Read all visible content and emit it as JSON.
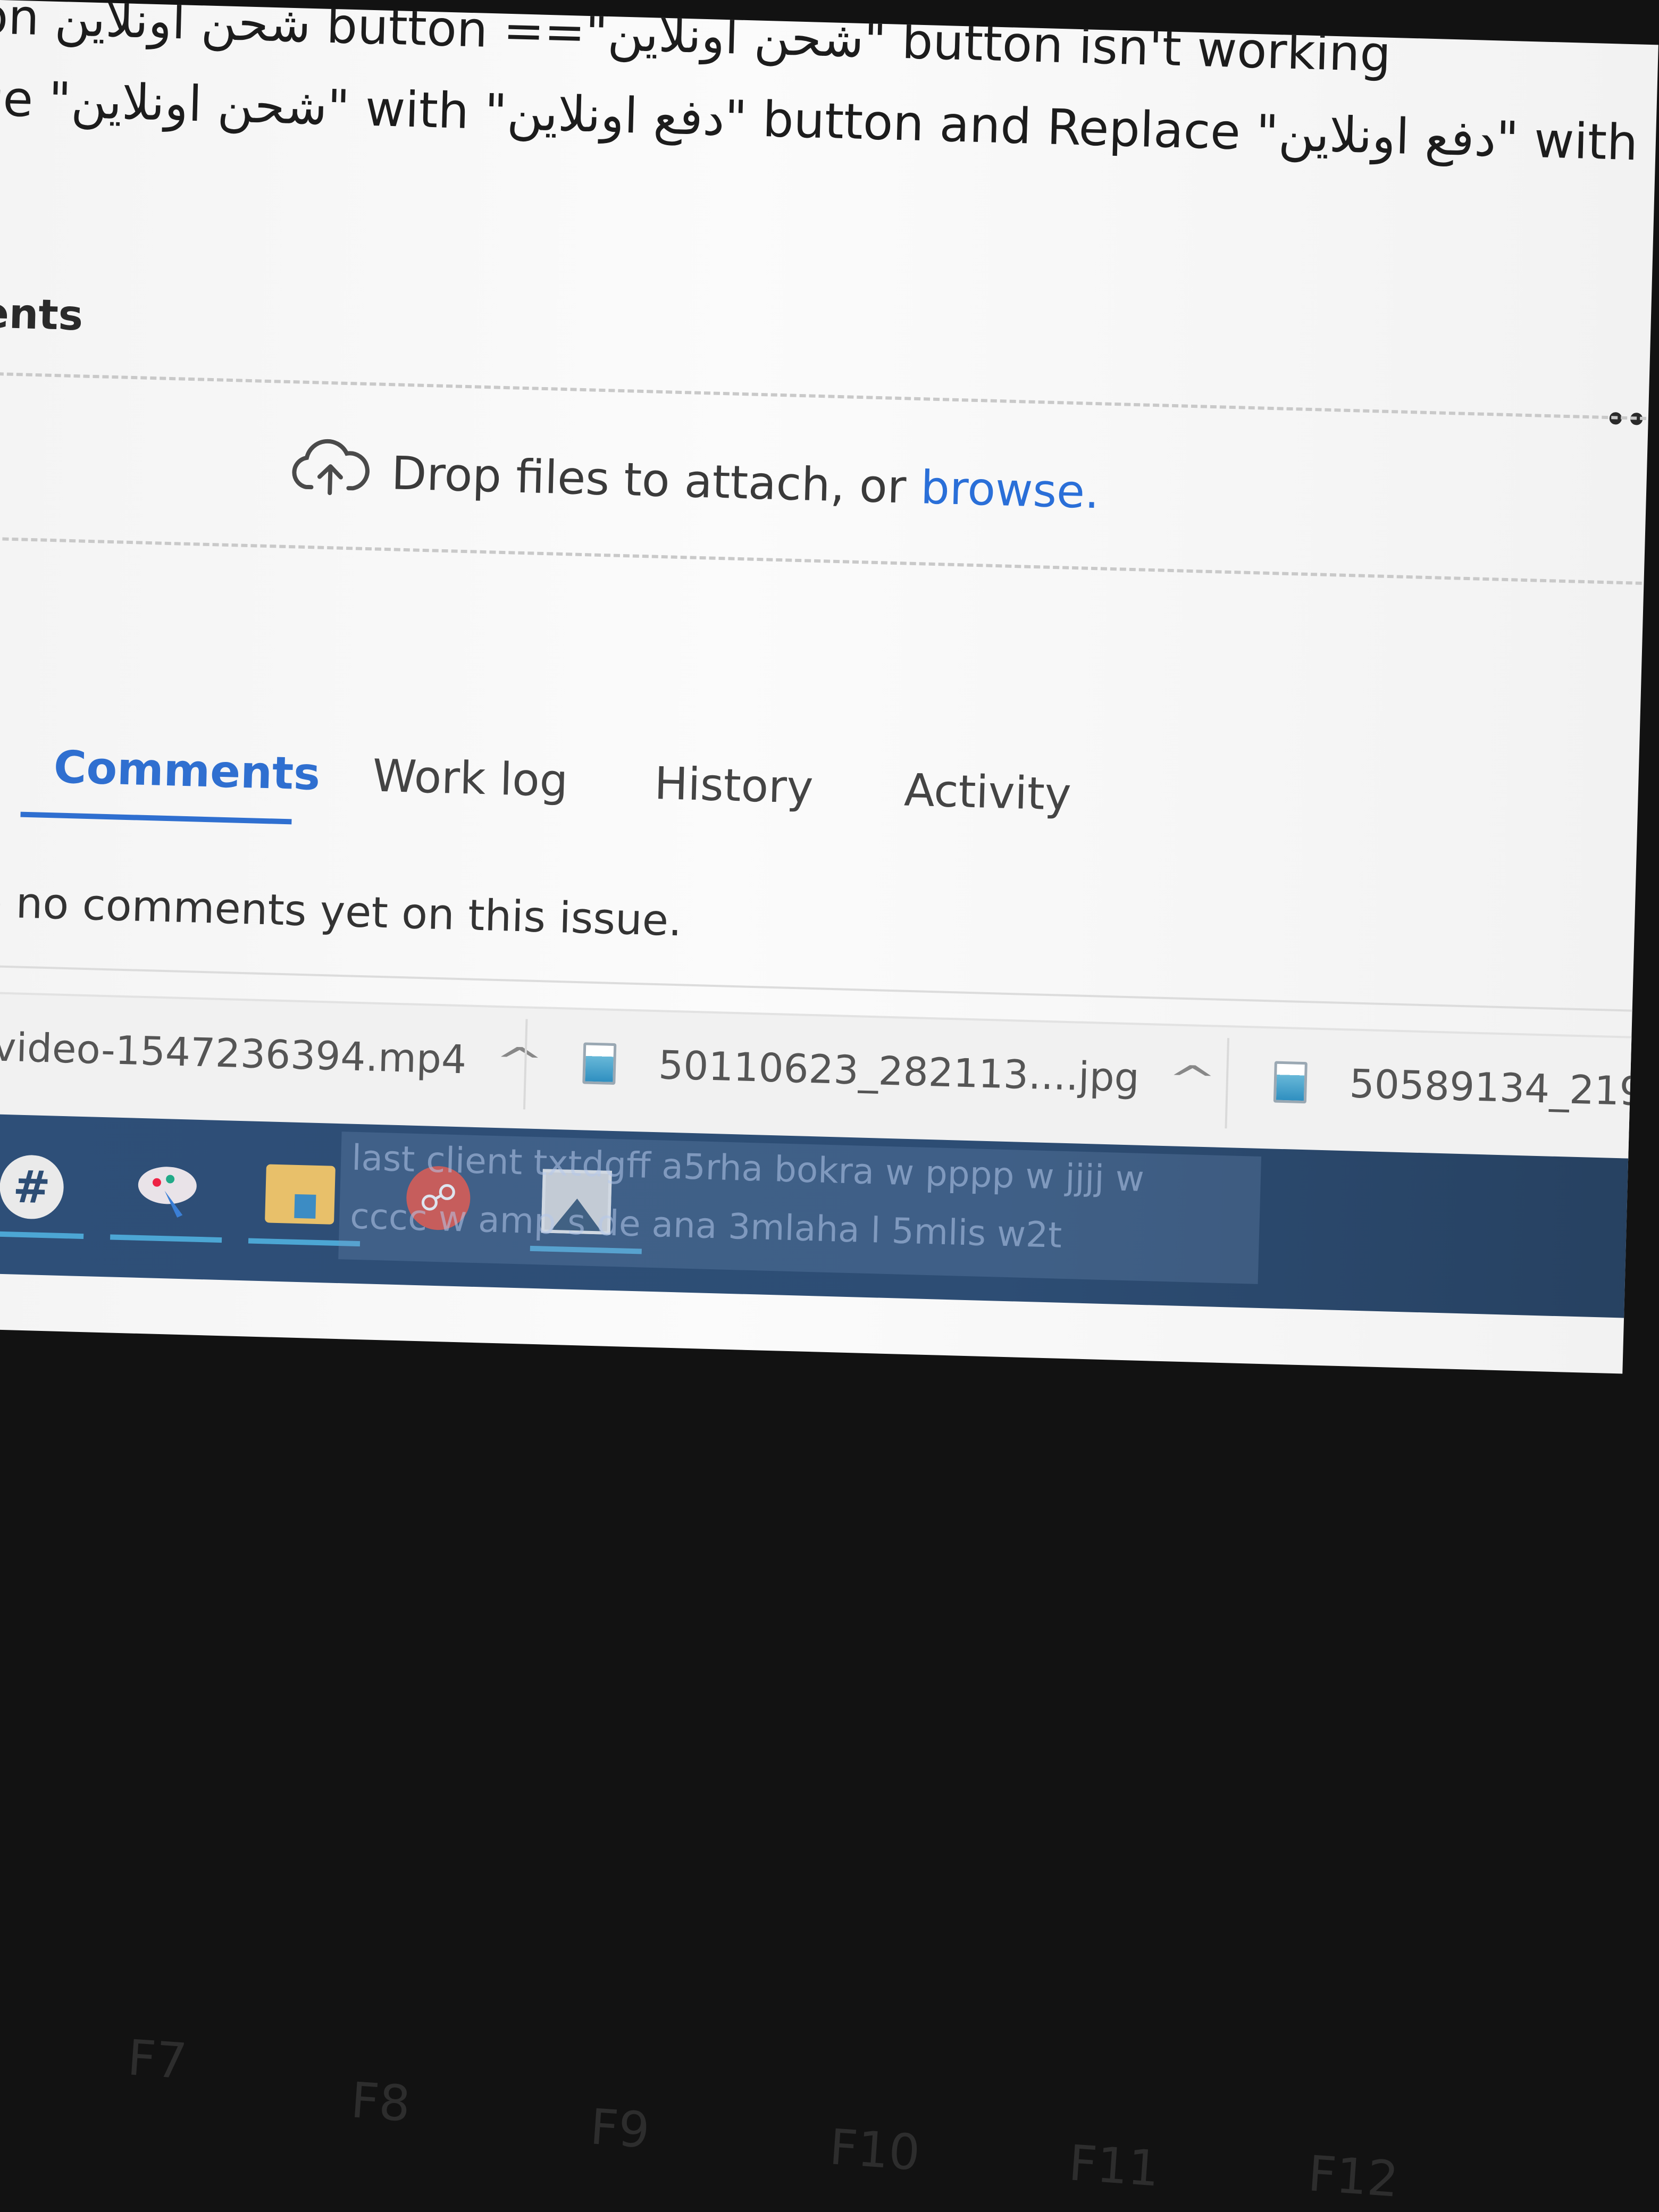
{
  "description": {
    "line1": "on  شحن اونلاين  button ==\"شحن اونلاين\" button isn't working",
    "line2": "ce \"شحن اونلاين\" with \"دفع اونلاين\" button and Replace \"دفع اونلاين\" with \"شحن\""
  },
  "attachments": {
    "heading": "ents",
    "drop_text": "Drop files to attach, or ",
    "browse_link": "browse."
  },
  "tabs": [
    {
      "label": "Comments",
      "active": true
    },
    {
      "label": "Work log",
      "active": false
    },
    {
      "label": "History",
      "active": false
    },
    {
      "label": "Activity",
      "active": false
    }
  ],
  "comments": {
    "empty_message": "re no comments yet on this issue."
  },
  "downloads": [
    {
      "name": "video-1547236394.mp4",
      "icon": "video-file-icon"
    },
    {
      "name": "50110623_282113....jpg",
      "icon": "image-file-icon"
    },
    {
      "name": "50589134_219",
      "icon": "image-file-icon"
    }
  ],
  "taskbar": {
    "apps": [
      "slack-icon",
      "paint-icon",
      "file-explorer-icon",
      "app-red-icon",
      "photos-icon"
    ],
    "preview_line1": "last client txtdgff a5rha bokra w pppp w jjjj w",
    "preview_line2": "cccc w  amp   s de ana 3mlaha l 5mlis w2t"
  },
  "keyboard": {
    "keys": [
      "F7",
      "F8",
      "F9",
      "F10",
      "F11",
      "F12"
    ]
  },
  "colors": {
    "accent": "#2f6fd0",
    "taskbar": "#2d4d74",
    "keyboard": "#121212"
  }
}
